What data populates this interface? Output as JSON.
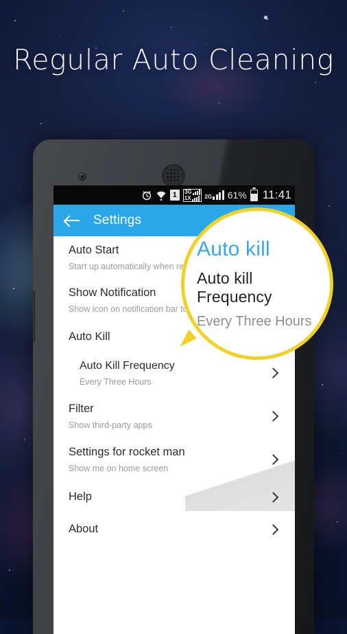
{
  "headline": "Regular Auto Cleaning",
  "statusbar": {
    "icons": [
      "alarm-icon",
      "wifi-icon",
      "sim-1-icon",
      "network-3g-1x-icon",
      "network-2g-icon"
    ],
    "sim_label": "1",
    "net_primary_top": "3G",
    "net_primary_bottom": "1X",
    "net_secondary": "2G",
    "battery_percent": "61%",
    "clock": "11:41"
  },
  "actionbar": {
    "back_icon": "back-arrow-icon",
    "title": "Settings",
    "background": "#29a7e8"
  },
  "settings": {
    "items": [
      {
        "title": "Auto Start",
        "subtitle": "Start up automatically when rest",
        "chevron": false,
        "indent": false,
        "section": false
      },
      {
        "title": "Show Notification",
        "subtitle": "Show icon on notification bar to s",
        "chevron": false,
        "indent": false,
        "section": false
      },
      {
        "title": "Auto Kill",
        "subtitle": "",
        "chevron": false,
        "indent": false,
        "section": true
      },
      {
        "title": "Auto Kill Frequency",
        "subtitle": "Every Three Hours",
        "chevron": true,
        "indent": true,
        "section": false
      },
      {
        "title": "Filter",
        "subtitle": "Show third-party apps",
        "chevron": true,
        "indent": false,
        "section": false
      },
      {
        "title": "Settings for rocket man",
        "subtitle": "Show me on home screen",
        "chevron": true,
        "indent": false,
        "section": false
      },
      {
        "title": "Help",
        "subtitle": "",
        "chevron": true,
        "indent": false,
        "section": false
      },
      {
        "title": "About",
        "subtitle": "",
        "chevron": true,
        "indent": false,
        "section": false
      }
    ]
  },
  "magnifier": {
    "heading": "Auto kill",
    "title": "Auto kill Frequency",
    "subtitle": "Every Three Hours",
    "border_color": "#f2d127",
    "heading_color": "#3ba7e8"
  }
}
